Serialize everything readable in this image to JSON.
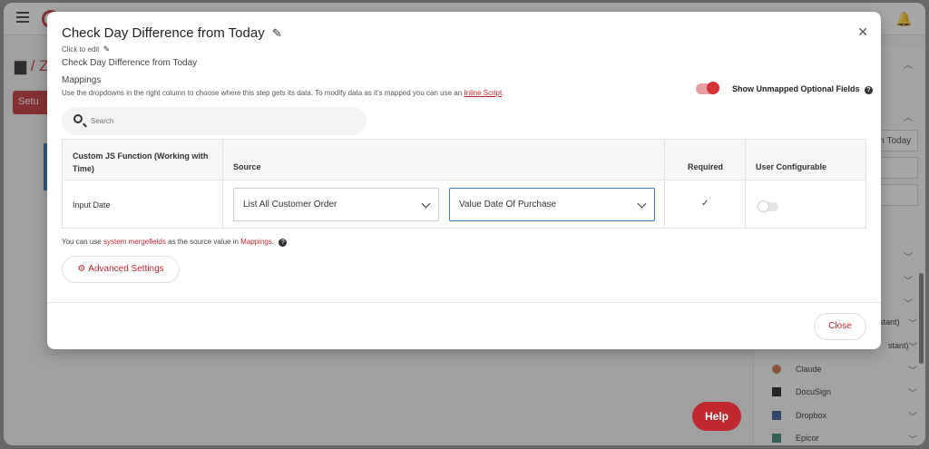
{
  "background": {
    "breadcrumb_sep": "/ Z",
    "setup_label": "Setu",
    "right_panel": {
      "box_text": "om Today",
      "items": [
        {
          "label": "stant)",
          "icon": "",
          "color": ""
        },
        {
          "label": "stant)",
          "icon": "",
          "color": ""
        },
        {
          "label": "Claude",
          "icon": "claude-icon",
          "color": "#c66a3d"
        },
        {
          "label": "DocuSign",
          "icon": "docusign-icon",
          "color": "#111111"
        },
        {
          "label": "Dropbox",
          "icon": "dropbox-icon",
          "color": "#2b4b9b"
        },
        {
          "label": "Epicor",
          "icon": "epicor-icon",
          "color": "#2e7d6b"
        }
      ]
    },
    "help_label": "Help"
  },
  "modal": {
    "title": "Check Day Difference from Today",
    "click_to_edit": "Click to edit",
    "description": "Check Day Difference from Today",
    "mappings_heading": "Mappings",
    "mappings_help_prefix": "Use the dropdowns in the right column to choose where this step gets its data. To modify data as it's mapped you can use an ",
    "mappings_help_link": "Inline Script",
    "mappings_help_suffix": ".",
    "show_unmapped_label": "Show Unmapped Optional Fields",
    "show_unmapped_on": true,
    "search_placeholder": "Search",
    "table": {
      "headers": {
        "field": "Custom JS Function (Working with Time)",
        "source": "Source",
        "required": "Required",
        "user_configurable": "User Configurable"
      },
      "rows": [
        {
          "field": "Input Date",
          "source_step": "List All Customer Order",
          "source_value": "Value Date Of Purchase",
          "required": "✓",
          "user_configurable": false
        }
      ]
    },
    "hint_prefix": "You can use ",
    "hint_link1": "system mergefields",
    "hint_mid": " as the source value in ",
    "hint_link2": "Mappings",
    "hint_suffix": ".",
    "advanced_settings_label": "Advanced Settings",
    "close_label": "Close"
  },
  "colors": {
    "accent": "#c0282d",
    "focus_border": "#3b78c3"
  }
}
